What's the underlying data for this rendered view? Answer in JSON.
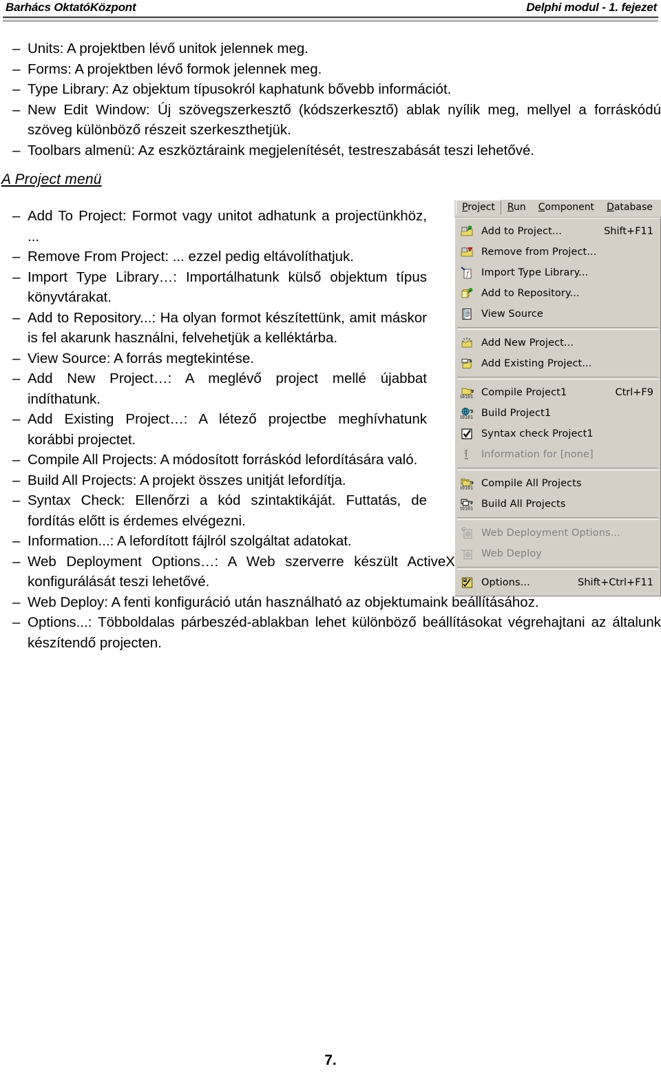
{
  "header": {
    "left": "Barhács OktatóKözpont",
    "right": "Delphi modul - 1. fejezet"
  },
  "page_number": "7.",
  "section_title": "A Project menü",
  "top_bullets": [
    {
      "dash": "–",
      "text": "Units: A projektben lévő unitok jelennek meg."
    },
    {
      "dash": "–",
      "text": "Forms: A projektben lévő formok jelennek meg."
    },
    {
      "dash": "–",
      "text": "Type Library: Az objektum típusokról kaphatunk bővebb információt."
    },
    {
      "dash": "–",
      "text": "New Edit Window: Új szövegszerkesztő (kódszerkesztő) ablak nyílik meg, mellyel a forráskódú szöveg különböző részeit szerkeszthetjük."
    },
    {
      "dash": "–",
      "text": "Toolbars almenü: Az eszköztáraink megjelenítését, testreszabását teszi lehetővé."
    }
  ],
  "narrow_bullets": [
    {
      "dash": "–",
      "text": "Add To Project: Formot vagy unitot adhatunk a projectünkhöz, ..."
    },
    {
      "dash": "–",
      "text": "Remove From Project: ... ezzel pedig eltávolíthatjuk."
    },
    {
      "dash": "–",
      "text": "Import Type Library…: Importálhatunk külső objektum típus könyvtárakat."
    },
    {
      "dash": "–",
      "text": "Add to Repository...: Ha olyan formot készítettünk, amit máskor is fel akarunk használni, felvehetjük a kelléktárba."
    },
    {
      "dash": "–",
      "text": "View Source: A forrás megtekintése."
    },
    {
      "dash": "–",
      "text": "Add New Project…: A meglévő project mellé újabbat indíthatunk."
    },
    {
      "dash": "–",
      "text": "Add Existing Project…: A létező projectbe meghívhatunk korábbi projectet."
    },
    {
      "dash": "–",
      "text": "Compile All Projects: A módosított forráskód lefordítására való."
    },
    {
      "dash": "–",
      "text": "Build All Projects: A projekt összes unitját lefordítja."
    },
    {
      "dash": "–",
      "text": "Syntax Check: Ellenőrzi a kód szintaktikáját. Futtatás, de fordítás előtt is érdemes elvégezni."
    },
    {
      "dash": "–",
      "text": "Information...: A lefordított fájlról szolgáltat adatokat."
    }
  ],
  "tail_bullets": [
    {
      "dash": "–",
      "text": "Web Deployment Options…: A Web szerverre készült ActiveX komponensekkel ellátott form konfigurálását teszi lehetővé."
    },
    {
      "dash": "–",
      "text": "Web Deploy: A fenti konfiguráció után használható az objektumaink beállításához."
    },
    {
      "dash": "–",
      "text": "Options...: Többoldalas párbeszéd-ablakban lehet különböző beállításokat végrehajtani az általunk készítendő projecten."
    }
  ],
  "delphi_menu": {
    "menubar": [
      {
        "pre": "",
        "acc": "P",
        "post": "roject",
        "selected": true
      },
      {
        "pre": "",
        "acc": "R",
        "post": "un",
        "selected": false
      },
      {
        "pre": "",
        "acc": "C",
        "post": "omponent",
        "selected": false
      },
      {
        "pre": "",
        "acc": "D",
        "post": "atabase",
        "selected": false
      }
    ],
    "items": [
      {
        "type": "item",
        "label": "Add to Project...",
        "shortcut": "Shift+F11",
        "icon": "folder-add-green-icon",
        "disabled": false
      },
      {
        "type": "item",
        "label": "Remove from Project...",
        "shortcut": "",
        "icon": "folder-remove-red-icon",
        "disabled": false
      },
      {
        "type": "item",
        "label": "Import Type Library...",
        "shortcut": "",
        "icon": "import-type-library-icon",
        "disabled": false
      },
      {
        "type": "item",
        "label": "Add to Repository...",
        "shortcut": "",
        "icon": "repository-add-icon",
        "disabled": false
      },
      {
        "type": "item",
        "label": "View Source",
        "shortcut": "",
        "icon": "document-lines-icon",
        "disabled": false
      },
      {
        "type": "separator"
      },
      {
        "type": "item",
        "label": "Add New Project...",
        "shortcut": "",
        "icon": "new-project-icon",
        "disabled": false
      },
      {
        "type": "item",
        "label": "Add Existing Project...",
        "shortcut": "",
        "icon": "existing-project-icon",
        "disabled": false
      },
      {
        "type": "separator"
      },
      {
        "type": "item",
        "label": "Compile Project1",
        "shortcut": "Ctrl+F9",
        "icon": "compile-project-icon",
        "disabled": false
      },
      {
        "type": "item",
        "label": "Build Project1",
        "shortcut": "",
        "icon": "build-project-globe-icon",
        "disabled": false
      },
      {
        "type": "item",
        "label": "Syntax check Project1",
        "shortcut": "",
        "icon": "checkmark-icon",
        "disabled": false
      },
      {
        "type": "item",
        "label": "Information for [none]",
        "shortcut": "",
        "icon": "information-icon",
        "disabled": true
      },
      {
        "type": "separator"
      },
      {
        "type": "item",
        "label": "Compile All Projects",
        "shortcut": "",
        "icon": "compile-all-icon",
        "disabled": false
      },
      {
        "type": "item",
        "label": "Build All Projects",
        "shortcut": "",
        "icon": "build-all-icon",
        "disabled": false
      },
      {
        "type": "separator"
      },
      {
        "type": "item",
        "label": "Web Deployment Options...",
        "shortcut": "",
        "icon": "web-deployment-options-icon",
        "disabled": true
      },
      {
        "type": "item",
        "label": "Web Deploy",
        "shortcut": "",
        "icon": "web-deploy-icon",
        "disabled": true
      },
      {
        "type": "separator"
      },
      {
        "type": "item",
        "label": "Options...",
        "shortcut": "Shift+Ctrl+F11",
        "icon": "options-checklist-icon",
        "disabled": false
      }
    ],
    "colors": {
      "face": "#d4d0c8",
      "folder": "#e8d86a",
      "folder_dark": "#8a7a20",
      "accent_green": "#2f9e2f",
      "accent_red": "#c02020",
      "disabled_text": "#808080"
    }
  }
}
